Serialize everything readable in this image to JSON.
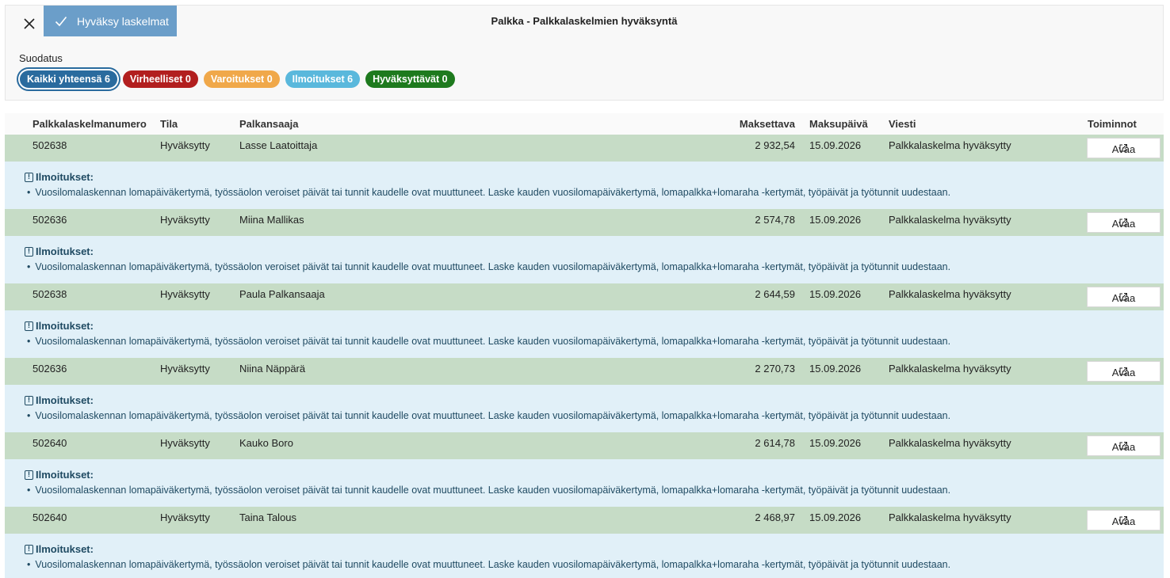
{
  "toolbar": {
    "close_icon": "close-icon",
    "approve_label": "Hyväksy laskelmat",
    "approve_icon": "checkmark-icon"
  },
  "page_title": "Palkka - Palkkalaskelmien hyväksyntä",
  "filter": {
    "label": "Suodatus",
    "pills": [
      {
        "label": "Kaikki yhteensä 6",
        "color": "#2a6b9e"
      },
      {
        "label": "Virheelliset 0",
        "color": "#b21f1f"
      },
      {
        "label": "Varoitukset 0",
        "color": "#f0a84a"
      },
      {
        "label": "Ilmoitukset 6",
        "color": "#5ab8dc"
      },
      {
        "label": "Hyväksyttävät 0",
        "color": "#1e7a1e"
      }
    ]
  },
  "table": {
    "columns": [
      "Palkkalaskelmanumero",
      "Tila",
      "Palkansaaja",
      "Maksettava",
      "Maksupäivä",
      "Viesti",
      "Toiminnot"
    ],
    "open_label": "Avaa",
    "notice_title": "Ilmoitukset:",
    "rows": [
      {
        "number": "502638",
        "status": "Hyväksytty",
        "recipient": "Lasse Laatoittaja",
        "amount": "2 932,54",
        "date": "15.09.2026",
        "message": "Palkkalaskelma hyväksytty",
        "notice": "Vuosilomalaskennan lomapäiväkertymä, työssäolon veroiset päivät tai tunnit kaudelle ovat muuttuneet. Laske kauden vuosilomapäiväkertymä, lomapalkka+lomaraha -kertymät, työpäivät ja työtunnit uudestaan."
      },
      {
        "number": "502636",
        "status": "Hyväksytty",
        "recipient": "Miina Mallikas",
        "amount": "2 574,78",
        "date": "15.09.2026",
        "message": "Palkkalaskelma hyväksytty",
        "notice": "Vuosilomalaskennan lomapäiväkertymä, työssäolon veroiset päivät tai tunnit kaudelle ovat muuttuneet. Laske kauden vuosilomapäiväkertymä, lomapalkka+lomaraha -kertymät, työpäivät ja työtunnit uudestaan."
      },
      {
        "number": "502638",
        "status": "Hyväksytty",
        "recipient": "Paula Palkansaaja",
        "amount": "2 644,59",
        "date": "15.09.2026",
        "message": "Palkkalaskelma hyväksytty",
        "notice": "Vuosilomalaskennan lomapäiväkertymä, työssäolon veroiset päivät tai tunnit kaudelle ovat muuttuneet. Laske kauden vuosilomapäiväkertymä, lomapalkka+lomaraha -kertymät, työpäivät ja työtunnit uudestaan."
      },
      {
        "number": "502636",
        "status": "Hyväksytty",
        "recipient": "Niina Näppärä",
        "amount": "2 270,73",
        "date": "15.09.2026",
        "message": "Palkkalaskelma hyväksytty",
        "notice": "Vuosilomalaskennan lomapäiväkertymä, työssäolon veroiset päivät tai tunnit kaudelle ovat muuttuneet. Laske kauden vuosilomapäiväkertymä, lomapalkka+lomaraha -kertymät, työpäivät ja työtunnit uudestaan."
      },
      {
        "number": "502640",
        "status": "Hyväksytty",
        "recipient": "Kauko Boro",
        "amount": "2 614,78",
        "date": "15.09.2026",
        "message": "Palkkalaskelma hyväksytty",
        "notice": "Vuosilomalaskennan lomapäiväkertymä, työssäolon veroiset päivät tai tunnit kaudelle ovat muuttuneet. Laske kauden vuosilomapäiväkertymä, lomapalkka+lomaraha -kertymät, työpäivät ja työtunnit uudestaan."
      },
      {
        "number": "502640",
        "status": "Hyväksytty",
        "recipient": "Taina Talous",
        "amount": "2 468,97",
        "date": "15.09.2026",
        "message": "Palkkalaskelma hyväksytty",
        "notice": "Vuosilomalaskennan lomapäiväkertymä, työssäolon veroiset päivät tai tunnit kaudelle ovat muuttuneet. Laske kauden vuosilomapäiväkertymä, lomapalkka+lomaraha -kertymät, työpäivät ja työtunnit uudestaan."
      }
    ]
  }
}
